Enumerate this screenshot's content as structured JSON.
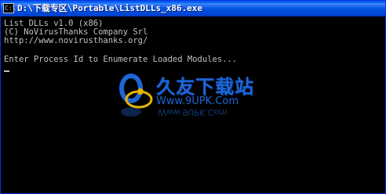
{
  "window": {
    "title": "D:\\下载专区\\Portable\\ListDLLs_x86.exe",
    "icon": "cmd-icon",
    "icon_glyph": "C:\\"
  },
  "console": {
    "lines": [
      "List DLLs v1.0 (x86)",
      "(C) NoVirusThanks Company Srl",
      "http://www.novirusthanks.org/",
      "",
      "Enter Process Id to Enumerate Loaded Modules..."
    ]
  },
  "watermark": {
    "brand": "久友下载站",
    "url": "Www.9UPK.Com",
    "reflection": "Www.9UPK.Com"
  },
  "colors": {
    "console_bg": "#000000",
    "console_fg": "#c0c0c0",
    "titlebar": "#0058ee",
    "watermark": "#1e66d8"
  }
}
